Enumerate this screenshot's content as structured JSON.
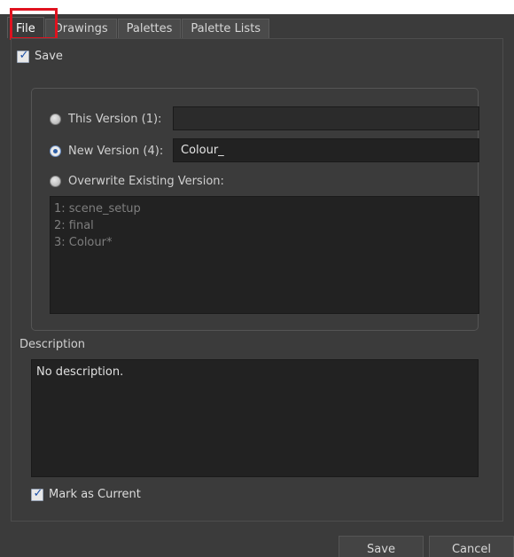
{
  "tabs": [
    {
      "label": "File"
    },
    {
      "label": "Drawings"
    },
    {
      "label": "Palettes"
    },
    {
      "label": "Palette Lists"
    }
  ],
  "save_checkbox": {
    "label": "Save",
    "checked": true
  },
  "version_options": {
    "this_version": {
      "label": "This Version (1):",
      "value": ""
    },
    "new_version": {
      "label": "New Version (4):",
      "value": "Colour_"
    },
    "overwrite": {
      "label": "Overwrite Existing Version:"
    }
  },
  "versions": [
    "1: scene_setup",
    "2: final",
    "3: Colour*"
  ],
  "description": {
    "label": "Description",
    "text": "No description."
  },
  "mark_current": {
    "label": "Mark as Current",
    "checked": true
  },
  "buttons": {
    "save": "Save",
    "cancel": "Cancel"
  },
  "colors": {
    "panel_bg": "#3b3b3b",
    "highlight": "#e0121f",
    "field_bg": "#222222"
  }
}
